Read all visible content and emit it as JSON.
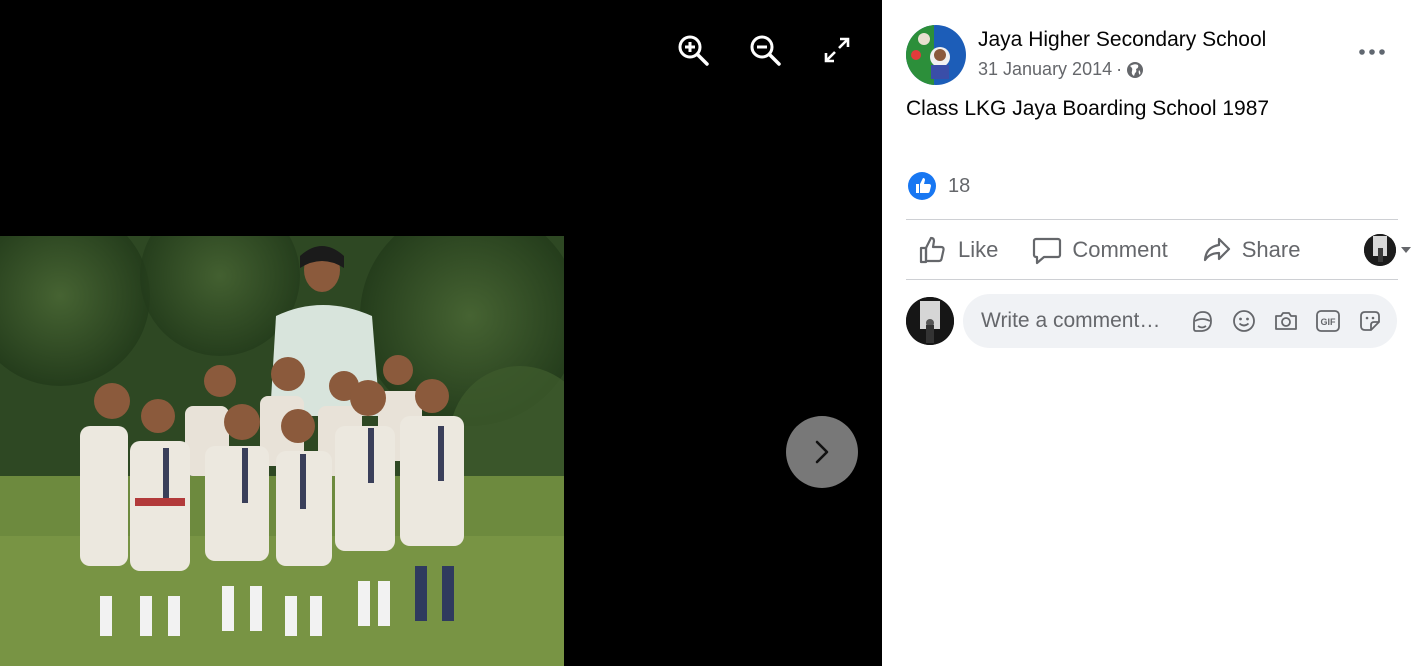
{
  "viewer": {
    "zoom_in_icon": "zoom-in-icon",
    "zoom_out_icon": "zoom-out-icon",
    "fullscreen_icon": "expand-icon",
    "next_icon": "chevron-right-icon",
    "photo_description": "group photo of children in school uniforms with a teacher"
  },
  "post": {
    "page_name": "Jaya Higher Secondary School",
    "date": "31 January 2014",
    "date_separator": "·",
    "audience_icon": "globe-icon",
    "more_icon": "more-dots-icon",
    "caption": "Class LKG Jaya Boarding School 1987",
    "reaction_count": "18",
    "reaction_icon": "like-reaction-icon"
  },
  "actions": {
    "like_label": "Like",
    "comment_label": "Comment",
    "share_label": "Share"
  },
  "comment": {
    "placeholder": "Write a comment…",
    "icons": [
      "avatar-sticker-icon",
      "emoji-icon",
      "camera-icon",
      "gif-icon",
      "sticker-icon"
    ]
  },
  "colors": {
    "accent": "#1877f2",
    "secondary_text": "#65676b",
    "primary_text": "#050505",
    "viewer_background": "#000000"
  }
}
